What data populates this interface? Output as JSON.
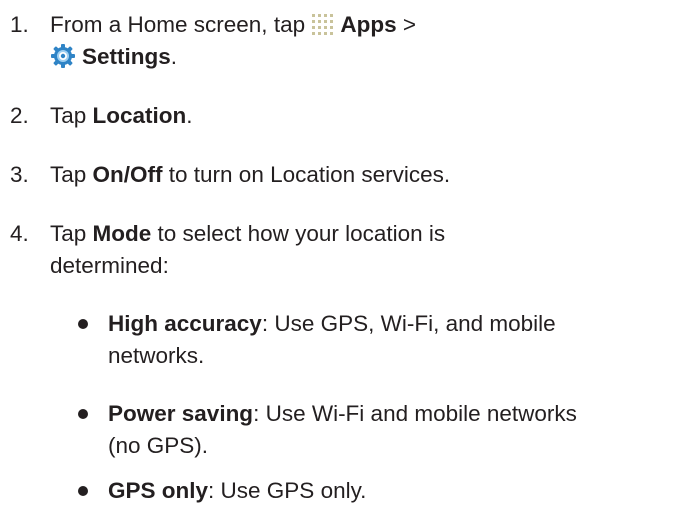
{
  "steps": [
    {
      "number": "1.",
      "prefix": "From a Home screen, tap ",
      "apps_label": "Apps",
      "separator": " >",
      "settings_label": "Settings",
      "suffix": "."
    },
    {
      "number": "2.",
      "prefix": "Tap ",
      "bold": "Location",
      "suffix": "."
    },
    {
      "number": "3.",
      "prefix": "Tap ",
      "bold": "On/Off",
      "suffix": " to turn on Location services."
    },
    {
      "number": "4.",
      "prefix": "Tap ",
      "bold": "Mode",
      "suffix_line1": " to select how your location is",
      "suffix_line2": "determined:"
    }
  ],
  "modes": [
    {
      "name": "High accuracy",
      "desc_line1": ": Use GPS, Wi-Fi, and mobile",
      "desc_line2": "networks."
    },
    {
      "name": "Power saving",
      "desc_line1": ": Use Wi-Fi and mobile networks",
      "desc_line2": "(no GPS)."
    },
    {
      "name": "GPS only",
      "desc_line1": ": Use GPS only.",
      "desc_line2": ""
    }
  ],
  "icons": {
    "apps": "apps-grid-icon",
    "settings": "settings-gear-icon"
  },
  "colors": {
    "text": "#231f20",
    "apps_icon": "#c9c39b",
    "settings_icon": "#2f84c6"
  }
}
